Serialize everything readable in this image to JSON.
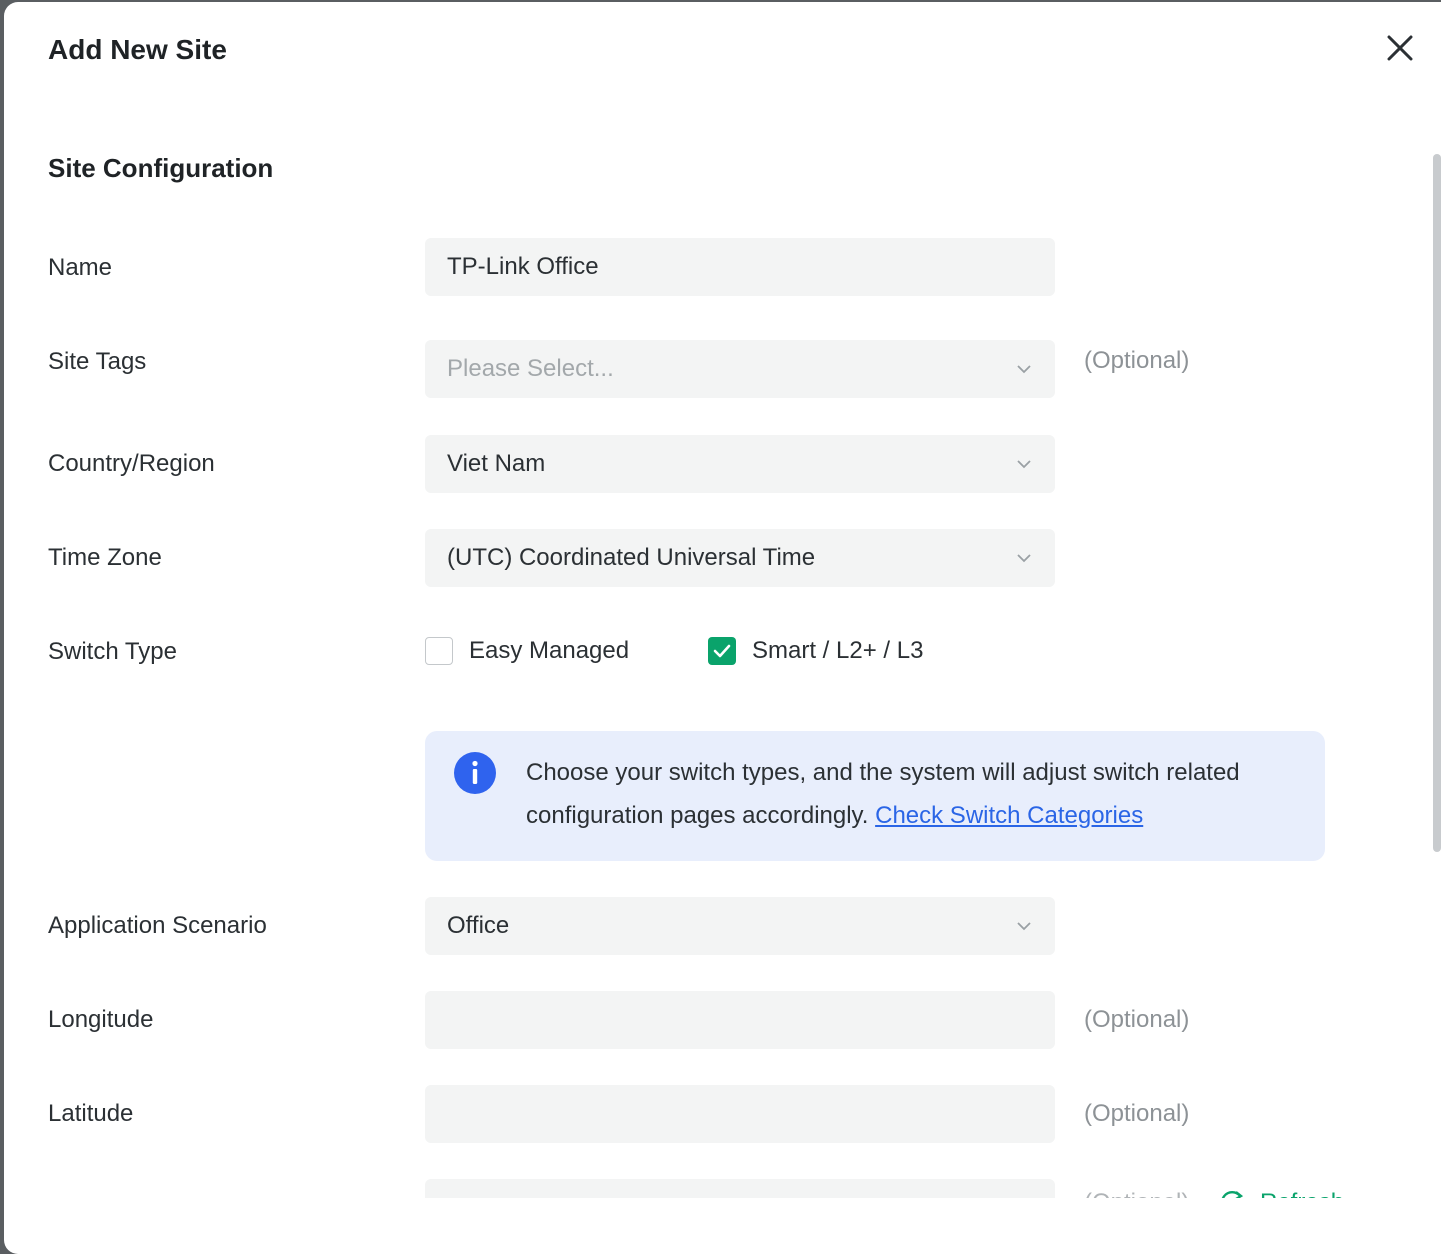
{
  "dialog": {
    "title": "Add New Site"
  },
  "section": {
    "title": "Site Configuration"
  },
  "fields": {
    "name": {
      "label": "Name",
      "value": "TP-Link Office"
    },
    "site_tags": {
      "label": "Site Tags",
      "placeholder": "Please Select...",
      "hint": "(Optional)"
    },
    "country": {
      "label": "Country/Region",
      "value": "Viet Nam"
    },
    "time_zone": {
      "label": "Time Zone",
      "value": "(UTC) Coordinated Universal Time"
    },
    "switch_type": {
      "label": "Switch Type",
      "options": [
        {
          "label": "Easy Managed",
          "checked": false
        },
        {
          "label": "Smart / L2+ / L3",
          "checked": true
        }
      ]
    },
    "info": {
      "text": "Choose your switch types, and the system will adjust switch related configuration pages accordingly. ",
      "link": "Check Switch Categories"
    },
    "scenario": {
      "label": "Application Scenario",
      "value": "Office"
    },
    "longitude": {
      "label": "Longitude",
      "value": "",
      "hint": "(Optional)"
    },
    "latitude": {
      "label": "Latitude",
      "value": "",
      "hint": "(Optional)"
    },
    "next_row": {
      "hint": "(Optional)",
      "action": "Refresh"
    }
  },
  "colors": {
    "accent_green": "#0aa36b",
    "link_blue": "#2a65e6",
    "info_bg": "#e8eefc",
    "info_icon": "#2f63ee"
  }
}
